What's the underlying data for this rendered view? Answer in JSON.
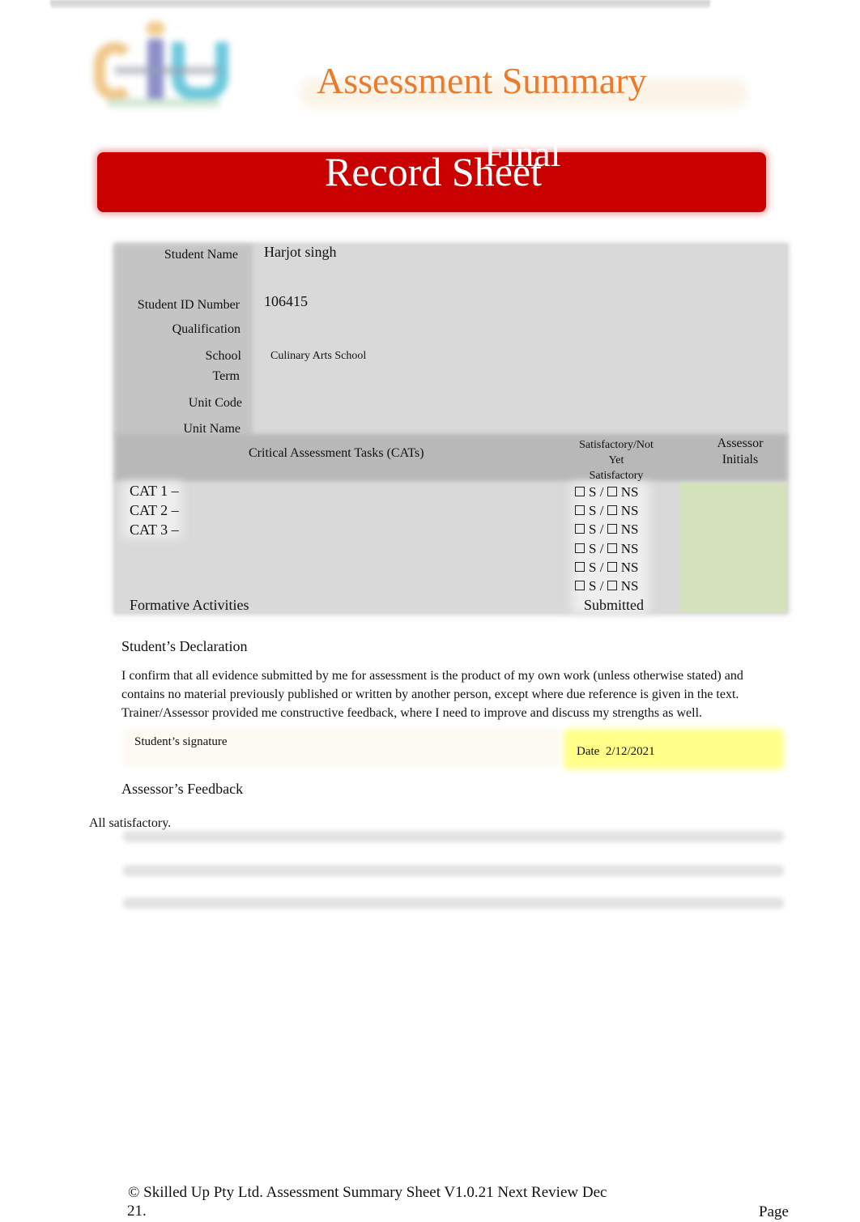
{
  "header": {
    "title": "Assessment Summary",
    "banner_title": "Record Sheet",
    "banner_suffix": "Final",
    "logo": "siu-logo",
    "colors": {
      "title": "#ec7a2c",
      "banner": "#c80000",
      "assessor_initials_fill": "#d6e2bb",
      "date_highlight": "#ffff8a"
    }
  },
  "student_info": {
    "fields": [
      {
        "label": "Student Name",
        "value": "Harjot singh"
      },
      {
        "label": "Student ID Number",
        "value": "106415"
      },
      {
        "label": "Qualification",
        "value": ""
      },
      {
        "label": "School",
        "value": "Culinary Arts School"
      },
      {
        "label": "Term",
        "value": ""
      },
      {
        "label": "Unit Code",
        "value": ""
      },
      {
        "label": "Unit Name",
        "value": ""
      }
    ]
  },
  "cat_table": {
    "headers": {
      "tasks": "Critical Assessment Tasks (CATs)",
      "status_line1": "Satisfactory/Not",
      "status_line2": "Yet",
      "status_line3": "Satisfactory",
      "initials_line1": "Assessor",
      "initials_line2": "Initials"
    },
    "rows": [
      {
        "task": "CAT 1 –",
        "s": "S /",
        "ns": "NS",
        "s_checked": false,
        "ns_checked": false
      },
      {
        "task": "CAT 2 –",
        "s": "S /",
        "ns": "NS",
        "s_checked": false,
        "ns_checked": false
      },
      {
        "task": "CAT 3 –",
        "s": "S /",
        "ns": "NS",
        "s_checked": false,
        "ns_checked": false
      },
      {
        "task": "",
        "s": "S /",
        "ns": "NS",
        "s_checked": false,
        "ns_checked": false
      },
      {
        "task": "",
        "s": "S /",
        "ns": "NS",
        "s_checked": false,
        "ns_checked": false
      },
      {
        "task": "",
        "s": "S /",
        "ns": "NS",
        "s_checked": false,
        "ns_checked": false
      }
    ],
    "formative": {
      "label": "Formative Activities",
      "status": "Submitted"
    }
  },
  "declaration": {
    "heading": "Student’s Declaration",
    "text": "I confirm that all evidence submitted by me for assessment is the product of my own work (unless otherwise stated) and contains no material previously published or written by another person, except where due reference is given in the text. Trainer/Assessor provided me constructive feedback, where I need to improve and discuss my strengths as well.",
    "signature_label": "Student’s signature",
    "date_label": "Date",
    "date_value": "2/12/2021"
  },
  "feedback": {
    "heading": "Assessor’s Feedback",
    "text": "All satisfactory."
  },
  "footer": {
    "line1": "© Skilled Up Pty Ltd. Assessment Summary Sheet V1.0.21 Next Review Dec",
    "line2": "21.",
    "page_label": "Page"
  }
}
